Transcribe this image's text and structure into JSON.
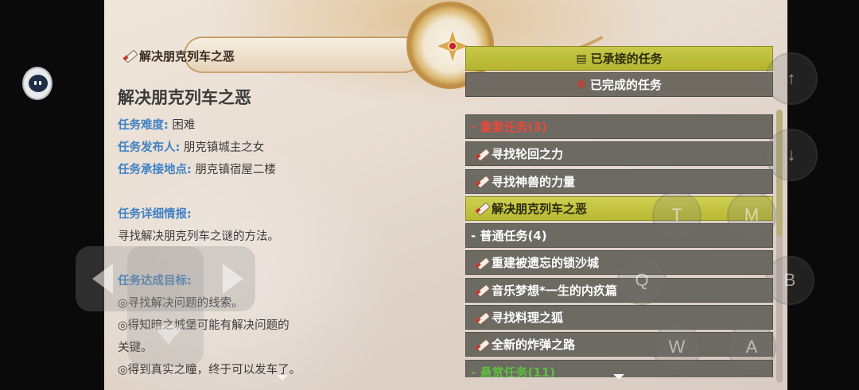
{
  "banner": {
    "title": "解决朋克列车之恶"
  },
  "quest": {
    "title": "解决朋克列车之恶",
    "difficulty_label": "任务难度:",
    "difficulty_value": "困难",
    "giver_label": "任务发布人:",
    "giver_value": "朋克镇城主之女",
    "location_label": "任务承接地点:",
    "location_value": "朋克镇宿屋二楼",
    "details_label": "任务详细情报:",
    "details_text": "寻找解决朋克列车之谜的方法。",
    "goals_label": "任务达成目标:",
    "goals": [
      "◎寻找解决问题的线索。",
      "◎得知暗之城堡可能有解决问题的",
      "关键。",
      "◎得到真实之瞳，终于可以发车了。"
    ]
  },
  "tabs": {
    "accepted": "已承接的任务",
    "completed": "已完成的任务"
  },
  "quest_list": {
    "important": {
      "label": "- 重要任务(3)",
      "items": [
        "寻找轮回之力",
        "寻找神兽的力量",
        "解决朋克列车之恶"
      ]
    },
    "normal": {
      "label": "- 普通任务(4)",
      "items": [
        "重建被遗忘的锁沙城",
        "音乐梦想*一生的内疚篇",
        "寻找料理之狐",
        "全新的炸弹之路"
      ]
    },
    "bounty": {
      "label": "- 悬赏任务(11)"
    },
    "selected_item": "解决朋克列车之恶"
  },
  "overlay": {
    "buttons": [
      "T",
      "M",
      "Q",
      "B",
      "W",
      "A"
    ],
    "arrows": [
      "↑",
      "↓"
    ]
  },
  "colors": {
    "accent_yellow": "#c8c84a",
    "label_blue": "#3f82c4",
    "important_red": "#e8493a",
    "bounty_green": "#5fbf3c"
  }
}
